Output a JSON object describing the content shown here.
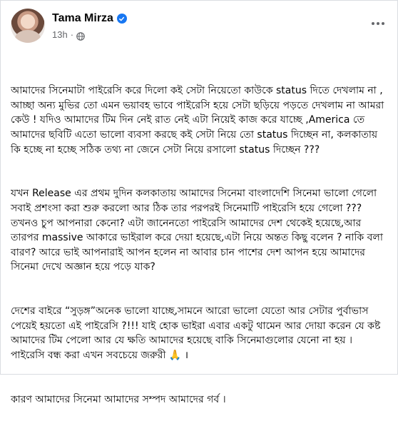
{
  "post": {
    "author_name": "Tama Mirza",
    "timestamp": "13h",
    "separator": "·",
    "privacy_icon": "globe-icon",
    "verified_icon": "verified-badge-icon",
    "more_icon": "more-options-icon",
    "paragraphs": [
      "আমাদের সিনেমাটা পাইরেসি করে দিলো কই সেটা নিয়েতো কাউকে status দিতে দেখলাম না , আচ্ছা অন্য মুভির তো এমন ভয়াবহ ভাবে পাইরেসি হয়ে সেটা ছড়িয়ে পড়তে দেখলাম না আমরা কেউ ! যদিও আমাদের টিম দিন নেই রাত নেই এটা নিয়েই কাজ করে যাচ্ছে ,America তে আমাদের ছবিটি এতো ভালো ব্যবসা করছে কই সেটা নিয়ে তো status দিচ্ছেন না, কলকাতায় কি হচ্ছে না হচ্ছে সঠিক তথ্য না জেনে সেটা নিয়ে রসালো status দিচ্ছেন ???",
      "যখন Release এর প্রথম দুদিন কলকাতায় আমাদের সিনেমা বাংলাদেশি সিনেমা ভালো গেলো সবাই প্রশংসা করা শুরু করলো আর ঠিক তার পরপরই সিনেমাটি পাইরেসি হয়ে গেলো ???তখনও চুপ আপনারা কেনো? এটা জানেনতো পাইরেসি আমাদের দেশ থেকেই হয়েছে,আর তারপর massive আকারে ভাইরাল করে দেয়া হয়েছে,এটা নিয়ে অন্তত কিছু বলেন ? নাকি বলা বারণ? আরে ভাই আপনারাই আপন হলেন না আবার চান পাশের দেশ আপন হয়ে আমাদের সিনেমা দেখে অজ্ঞান হয়ে পড়ে যাক?",
      "দেশের বাইরে “সুড়ঙ্গ”অনেক ভালো যাচ্ছে,সামনে আরো ভালো যেতো আর সেটার পুর্বাভাস পেয়েই হয়তো এই পাইরেসি ?!!! যাই হোক ভাইরা এবার একটু থামেন আর দোয়া করেন যে কষ্ট আমাদের টিম পেলো আর যে ক্ষতি আমাদের হয়েছে বাকি সিনেমাগুলোর যেনো না হয় । পাইরেসি বন্ধ করা এখন সবচেয়ে জরুরী 🙏 ।",
      "কারণ আমাদের সিনেমা আমাদের সম্পদ আমাদের গর্ব ।"
    ]
  },
  "colors": {
    "text_primary": "#050505",
    "text_secondary": "#65676b",
    "verified_blue": "#1877f2",
    "border": "#dadde1"
  }
}
